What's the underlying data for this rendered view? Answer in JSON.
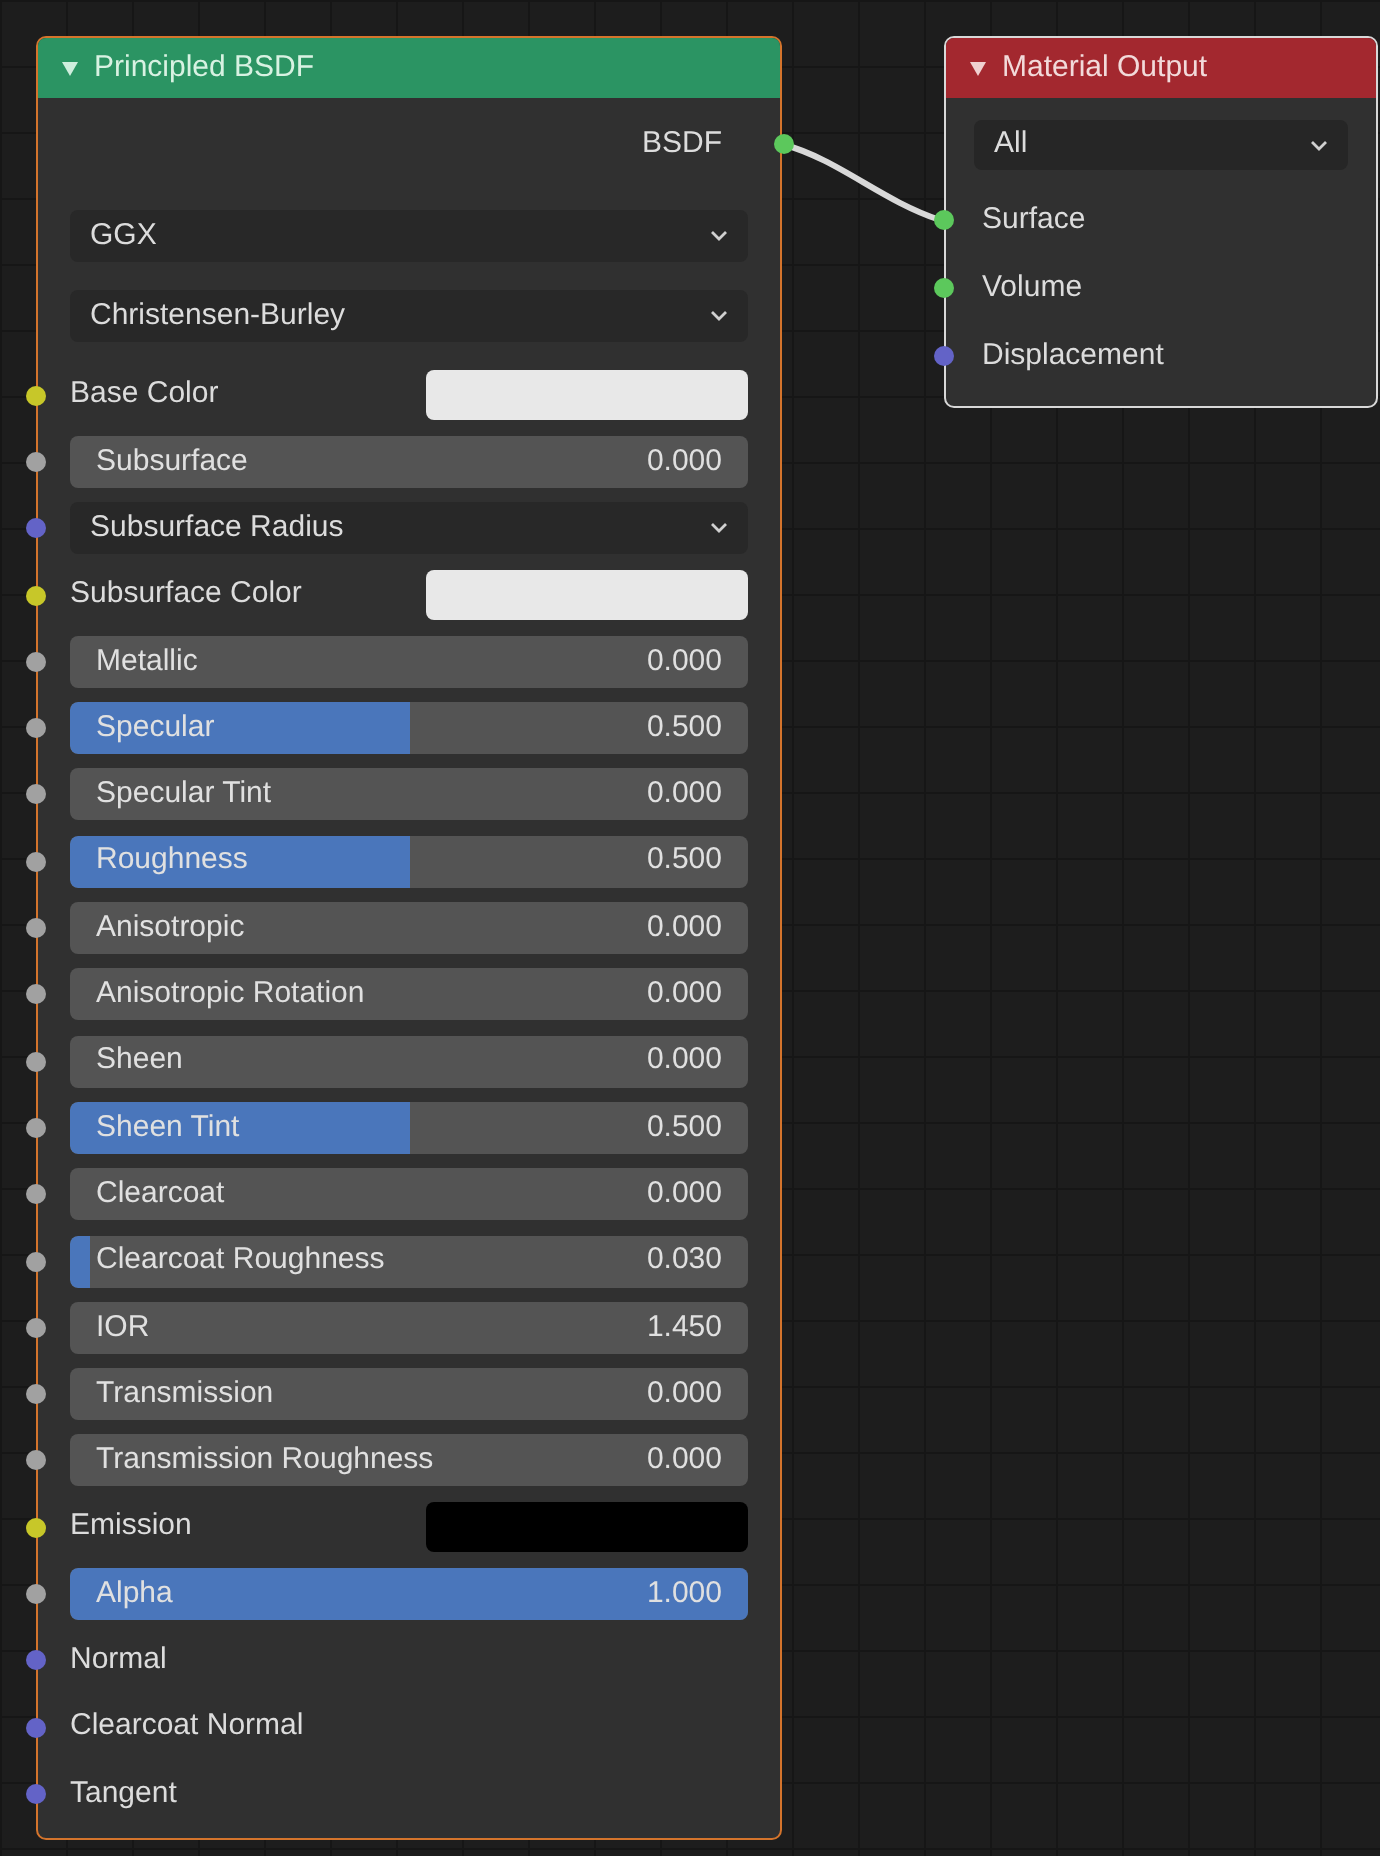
{
  "principled_node": {
    "title": "Principled BSDF",
    "selected": true,
    "output": {
      "label": "BSDF",
      "color": "#5cc85c"
    },
    "dropdowns": [
      {
        "value": "GGX"
      },
      {
        "value": "Christensen-Burley"
      }
    ],
    "inputs": [
      {
        "kind": "color",
        "label": "Base Color",
        "color": "#c7c729",
        "swatch": {
          "color": "#e8e8e8"
        }
      },
      {
        "kind": "slider",
        "label": "Subsurface",
        "value": "0.000",
        "level": 0,
        "color": "#a1a1a1"
      },
      {
        "kind": "dropdown",
        "label": "Subsurface Radius",
        "color": "#6363c7"
      },
      {
        "kind": "color",
        "label": "Subsurface Color",
        "color": "#c7c729",
        "swatch": {
          "color": "#e8e8e8"
        }
      },
      {
        "kind": "slider",
        "label": "Metallic",
        "value": "0.000",
        "level": 0,
        "color": "#a1a1a1"
      },
      {
        "kind": "slider",
        "label": "Specular",
        "value": "0.500",
        "level": 0.5,
        "color": "#a1a1a1"
      },
      {
        "kind": "slider",
        "label": "Specular Tint",
        "value": "0.000",
        "level": 0,
        "color": "#a1a1a1"
      },
      {
        "kind": "slider",
        "label": "Roughness",
        "value": "0.500",
        "level": 0.5,
        "color": "#a1a1a1"
      },
      {
        "kind": "slider",
        "label": "Anisotropic",
        "value": "0.000",
        "level": 0,
        "color": "#a1a1a1"
      },
      {
        "kind": "slider",
        "label": "Anisotropic Rotation",
        "value": "0.000",
        "level": 0,
        "color": "#a1a1a1"
      },
      {
        "kind": "slider",
        "label": "Sheen",
        "value": "0.000",
        "level": 0,
        "color": "#a1a1a1"
      },
      {
        "kind": "slider",
        "label": "Sheen Tint",
        "value": "0.500",
        "level": 0.5,
        "color": "#a1a1a1"
      },
      {
        "kind": "slider",
        "label": "Clearcoat",
        "value": "0.000",
        "level": 0,
        "color": "#a1a1a1"
      },
      {
        "kind": "slider",
        "label": "Clearcoat Roughness",
        "value": "0.030",
        "level": 0.03,
        "color": "#a1a1a1"
      },
      {
        "kind": "number",
        "label": "IOR",
        "value": "1.450",
        "color": "#a1a1a1"
      },
      {
        "kind": "slider",
        "label": "Transmission",
        "value": "0.000",
        "level": 0,
        "color": "#a1a1a1"
      },
      {
        "kind": "slider",
        "label": "Transmission Roughness",
        "value": "0.000",
        "level": 0,
        "color": "#a1a1a1"
      },
      {
        "kind": "color",
        "label": "Emission",
        "color": "#c7c729",
        "swatch": {
          "color": "#000000"
        }
      },
      {
        "kind": "slider",
        "label": "Alpha",
        "value": "1.000",
        "level": 1,
        "color": "#a1a1a1"
      },
      {
        "kind": "socket",
        "label": "Normal",
        "color": "#6363c7"
      },
      {
        "kind": "socket",
        "label": "Clearcoat Normal",
        "color": "#6363c7"
      },
      {
        "kind": "socket",
        "label": "Tangent",
        "color": "#6363c7"
      }
    ]
  },
  "output_node": {
    "title": "Material Output",
    "selected": true,
    "dropdown": {
      "value": "All"
    },
    "inputs": [
      {
        "label": "Surface",
        "color": "#5cc85c"
      },
      {
        "label": "Volume",
        "color": "#5cc85c"
      },
      {
        "label": "Displacement",
        "color": "#6363c7"
      }
    ]
  }
}
